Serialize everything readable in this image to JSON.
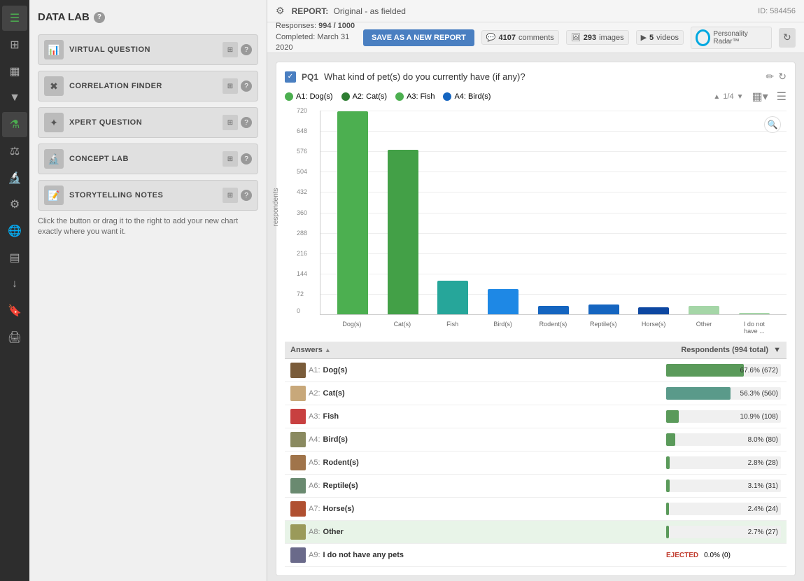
{
  "nav": {
    "icons": [
      {
        "name": "menu-icon",
        "symbol": "☰"
      },
      {
        "name": "layout-icon",
        "symbol": "▦"
      },
      {
        "name": "chart-icon",
        "symbol": "📊"
      },
      {
        "name": "filter-icon",
        "symbol": "▼"
      },
      {
        "name": "flask-icon",
        "symbol": "⚗"
      },
      {
        "name": "scale-icon",
        "symbol": "⚖"
      },
      {
        "name": "microscope-icon",
        "symbol": "🔬"
      },
      {
        "name": "settings-icon",
        "symbol": "⚙"
      },
      {
        "name": "globe-icon",
        "symbol": "🌐"
      },
      {
        "name": "layers-icon",
        "symbol": "▤"
      },
      {
        "name": "download-icon",
        "symbol": "↓"
      },
      {
        "name": "bookmark-icon",
        "symbol": "🔖"
      },
      {
        "name": "print-icon",
        "symbol": "🖨"
      }
    ]
  },
  "sidebar": {
    "title": "DATA LAB",
    "help_label": "?",
    "buttons": [
      {
        "id": "virtual-question",
        "icon": "📊",
        "label": "VIRTUAL QUESTION"
      },
      {
        "id": "correlation-finder",
        "icon": "✖",
        "label": "CORRELATION FINDER"
      },
      {
        "id": "xpert-question",
        "icon": "✦",
        "label": "XPERT QUESTION"
      },
      {
        "id": "concept-lab",
        "icon": "🔬",
        "label": "CONCEPT LAB"
      },
      {
        "id": "storytelling-notes",
        "icon": "📝",
        "label": "STORYTELLING NOTES"
      }
    ],
    "hint": "Click the button or drag it to the right to add your new chart exactly where you want it."
  },
  "topbar": {
    "gear": "⚙",
    "report_label": "REPORT:",
    "report_value": "Original - as fielded",
    "id_label": "ID: 584456"
  },
  "secondbar": {
    "responses_label": "Responses:",
    "responses_value": "994 / 1000",
    "completed_label": "Completed:",
    "completed_value": "March 31 2020",
    "save_button": "SAVE AS A NEW REPORT",
    "comments_count": "4107",
    "comments_label": "comments",
    "images_count": "293",
    "images_label": "images",
    "videos_count": "5",
    "videos_label": "videos",
    "personality_label": "Personality Radar™",
    "refresh": "↻"
  },
  "question": {
    "checkbox": "✓",
    "code": "PQ1",
    "text": "What kind of pet(s) do you currently have (if any)?",
    "legend": [
      {
        "color": "#4caf50",
        "label": "A1: Dog(s)"
      },
      {
        "color": "#2e7d32",
        "label": "A2: Cat(s)"
      },
      {
        "color": "#4caf50",
        "label": "A3: Fish"
      },
      {
        "color": "#1565c0",
        "label": "A4: Bird(s)"
      }
    ],
    "pagination": "1/4",
    "y_label": "respondents",
    "y_values": [
      "720",
      "648",
      "576",
      "504",
      "432",
      "360",
      "288",
      "216",
      "144",
      "72",
      "0"
    ],
    "bars": [
      {
        "label": "Dog(s)",
        "height_pct": 98,
        "color": "#4caf50"
      },
      {
        "label": "Cat(s)",
        "height_pct": 82,
        "color": "#43a047"
      },
      {
        "label": "Fish",
        "height_pct": 16,
        "color": "#26a69a"
      },
      {
        "label": "Bird(s)",
        "height_pct": 12,
        "color": "#1e88e5"
      },
      {
        "label": "Rodent(s)",
        "height_pct": 4,
        "color": "#1565c0"
      },
      {
        "label": "Reptile(s)",
        "height_pct": 5,
        "color": "#1565c0"
      },
      {
        "label": "Horse(s)",
        "height_pct": 3,
        "color": "#0d47a1"
      },
      {
        "label": "Other",
        "height_pct": 4,
        "color": "#a5d6a7"
      },
      {
        "label": "I do not have ...",
        "height_pct": 0,
        "color": "#a5d6a7"
      }
    ]
  },
  "answers": {
    "col_answers": "Answers",
    "col_respondents": "Respondents (994 total)",
    "rows": [
      {
        "code": "A1:",
        "name": "Dog(s)",
        "img_class": "dog",
        "pct": "67.6%",
        "count": "(672)",
        "bar_pct": 67.6,
        "bar_color": "#5a9a5a",
        "highlight": ""
      },
      {
        "code": "A2:",
        "name": "Cat(s)",
        "img_class": "cat",
        "pct": "56.3%",
        "count": "(560)",
        "bar_pct": 56.3,
        "bar_color": "#5a9a8a",
        "highlight": ""
      },
      {
        "code": "A3:",
        "name": "Fish",
        "img_class": "fish",
        "pct": "10.9%",
        "count": "(108)",
        "bar_pct": 10.9,
        "bar_color": "#5a9a5a",
        "highlight": ""
      },
      {
        "code": "A4:",
        "name": "Bird(s)",
        "img_class": "bird",
        "pct": "8.0%",
        "count": "(80)",
        "bar_pct": 8.0,
        "bar_color": "#5a9a5a",
        "highlight": ""
      },
      {
        "code": "A5:",
        "name": "Rodent(s)",
        "img_class": "rodent",
        "pct": "2.8%",
        "count": "(28)",
        "bar_pct": 2.8,
        "bar_color": "#5a9a5a",
        "highlight": ""
      },
      {
        "code": "A6:",
        "name": "Reptile(s)",
        "img_class": "reptile",
        "pct": "3.1%",
        "count": "(31)",
        "bar_pct": 3.1,
        "bar_color": "#5a9a5a",
        "highlight": ""
      },
      {
        "code": "A7:",
        "name": "Horse(s)",
        "img_class": "horse",
        "pct": "2.4%",
        "count": "(24)",
        "bar_pct": 2.4,
        "bar_color": "#5a9a5a",
        "highlight": ""
      },
      {
        "code": "A8:",
        "name": "Other",
        "img_class": "other",
        "pct": "2.7%",
        "count": "(27)",
        "bar_pct": 2.7,
        "bar_color": "#5a9a5a",
        "highlight": "highlight"
      },
      {
        "code": "A9:",
        "name": "I do not have any pets",
        "img_class": "none",
        "pct": "0.0%",
        "count": "(0)",
        "bar_pct": 0,
        "bar_color": "#5a9a5a",
        "ejected": "EJECTED",
        "highlight": ""
      }
    ]
  }
}
